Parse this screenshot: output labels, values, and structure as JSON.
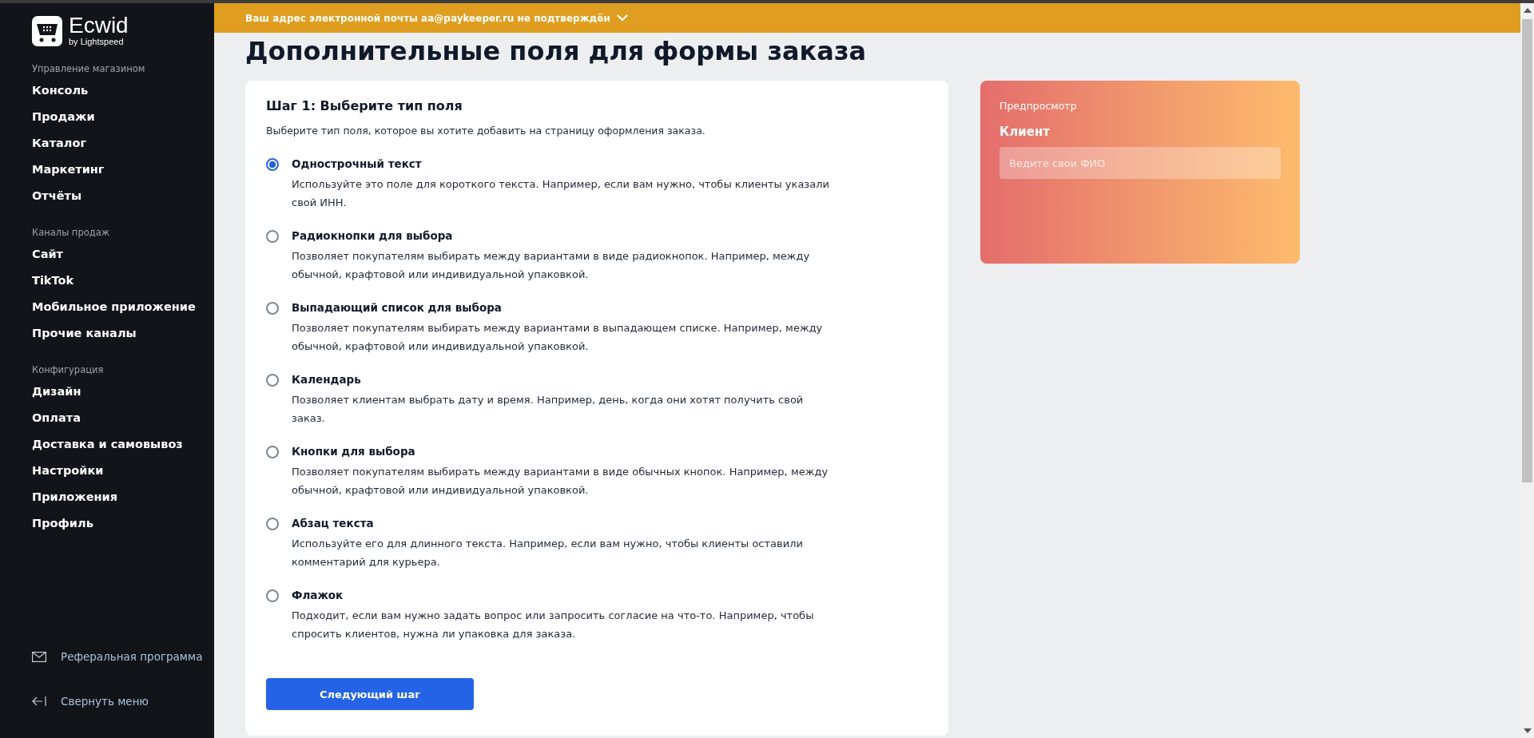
{
  "sidebar": {
    "logo": {
      "name": "Ecwid",
      "tagline": "by Lightspeed"
    },
    "sections": [
      {
        "title": "Управление магазином",
        "items": [
          "Консоль",
          "Продажи",
          "Каталог",
          "Маркетинг",
          "Отчёты"
        ]
      },
      {
        "title": "Каналы продаж",
        "items": [
          "Сайт",
          "TikTok",
          "Мобильное приложение",
          "Прочие каналы"
        ]
      },
      {
        "title": "Конфигурация",
        "items": [
          "Дизайн",
          "Оплата",
          "Доставка и самовывоз",
          "Настройки",
          "Приложения",
          "Профиль"
        ]
      }
    ],
    "footer": [
      {
        "kind": "mail",
        "label": "Реферальная программа"
      },
      {
        "kind": "collapse",
        "label": "Свернуть меню"
      }
    ]
  },
  "banner": {
    "text": "Ваш адрес электронной почты aa@paykeeper.ru не подтверждён"
  },
  "page_title": "Дополнительные поля для формы заказа",
  "step": {
    "title": "Шаг 1: Выберите тип поля",
    "subtitle": "Выберите тип поля, которое вы хотите добавить на страницу оформления заказа.",
    "options": [
      {
        "label": "Однострочный текст",
        "description": "Используйте это поле для короткого текста. Например, если вам нужно, чтобы клиенты указали свой ИНН.",
        "selected": true
      },
      {
        "label": "Радиокнопки для выбора",
        "description": "Позволяет покупателям выбирать между вариантами в виде радиокнопок. Например, между обычной, крафтовой или индивидуальной упаковкой.",
        "selected": false
      },
      {
        "label": "Выпадающий список для выбора",
        "description": "Позволяет покупателям выбирать между вариантами в выпадающем списке. Например, между обычной, крафтовой или индивидуальной упаковкой.",
        "selected": false
      },
      {
        "label": "Календарь",
        "description": "Позволяет клиентам выбрать дату и время. Например, день, когда они хотят получить свой заказ.",
        "selected": false
      },
      {
        "label": "Кнопки для выбора",
        "description": "Позволяет покупателям выбирать между вариантами в виде обычных кнопок. Например, между обычной, крафтовой или индивидуальной упаковкой.",
        "selected": false
      },
      {
        "label": "Абзац текста",
        "description": "Используйте его для длинного текста. Например, если вам нужно, чтобы клиенты оставили комментарий для курьера.",
        "selected": false
      },
      {
        "label": "Флажок",
        "description": "Подходит, если вам нужно задать вопрос или запросить согласие на что-то. Например, чтобы спросить клиентов, нужна ли упаковка для заказа.",
        "selected": false
      }
    ],
    "next_button": "Следующий шаг"
  },
  "preview": {
    "title": "Предпросмотр",
    "field_label": "Клиент",
    "placeholder": "Ведите свои ФИО"
  }
}
